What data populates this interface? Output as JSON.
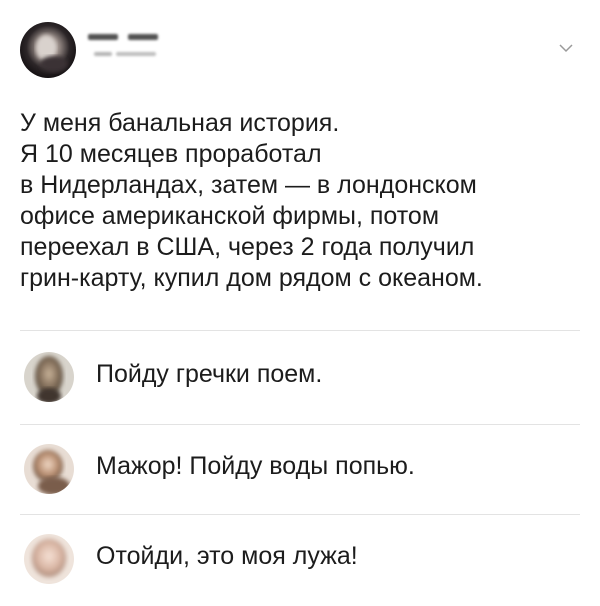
{
  "post": {
    "author": {
      "avatar_icon": "author-avatar-photo",
      "name_blurred": "",
      "sub_blurred": ""
    },
    "menu_icon": "chevron-down-icon",
    "text_lines": [
      "У меня банальная история.",
      "Я 10 месяцев проработал",
      "в Нидерландах, затем — в лондонском",
      "офисе американской фирмы, потом",
      "переехал в США, через 2 года получил",
      "грин-карту, купил дом рядом с океаном."
    ]
  },
  "comments": [
    {
      "avatar_icon": "user-avatar-photo",
      "text": "Пойду гречки поем."
    },
    {
      "avatar_icon": "user-avatar-photo",
      "text": "Мажор! Пойду воды попью."
    },
    {
      "avatar_icon": "user-avatar-photo",
      "text": "Отойди, это моя лужа!"
    }
  ],
  "colors": {
    "text": "#1c1c1c",
    "divider": "#e3e3e3",
    "chevron": "#9a9a9a",
    "background": "#ffffff"
  }
}
